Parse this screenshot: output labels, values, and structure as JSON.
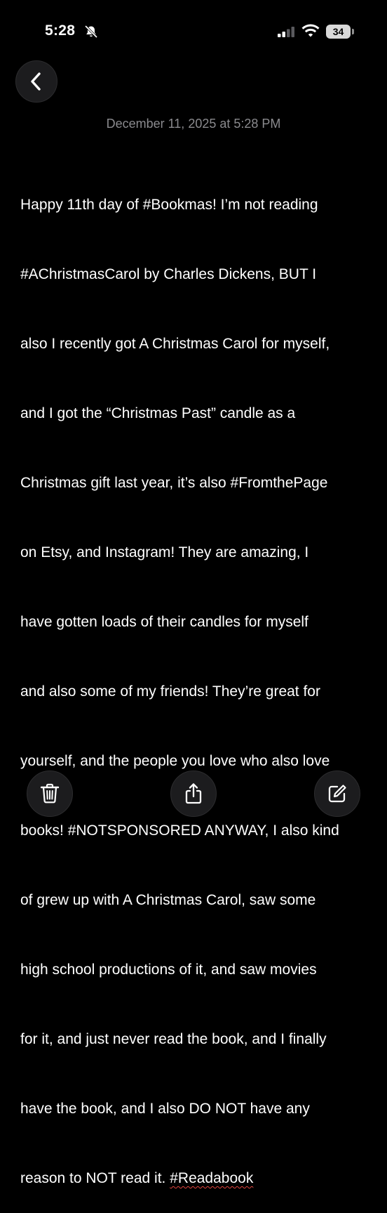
{
  "status_bar": {
    "time": "5:28",
    "battery_level": "34",
    "icons": [
      "bell-slash-icon",
      "cellular-signal-icon",
      "wifi-icon",
      "battery-icon"
    ]
  },
  "navigation": {
    "back_icon": "chevron-left-icon"
  },
  "note": {
    "date": "December 11, 2025 at 5:28 PM",
    "body_lines": [
      "Happy 11th day of #Bookmas! I’m not reading",
      "#AChristmasCarol by Charles Dickens, BUT I",
      "also I recently got A Christmas Carol for myself,",
      "and I got the “Christmas Past” candle as a",
      "Christmas gift last year, it’s also #FromthePage",
      "on Etsy, and Instagram! They are amazing, I",
      "have gotten loads of their candles for myself",
      "and also some of my friends! They’re great for",
      "yourself, and the people you love who also love",
      "books! #NOTSPONSORED ANYWAY, I also kind",
      "of grew up with A Christmas Carol, saw some",
      "high school productions of it, and saw movies",
      "for it, and just never read the book, and I finally",
      "have the book, and I also DO NOT have any",
      "reason to NOT read it. "
    ],
    "misspelled_word": "#Readabook"
  },
  "toolbar": {
    "icons": [
      "trash-icon",
      "share-icon",
      "compose-icon"
    ]
  },
  "colors": {
    "background": "#000000",
    "text": "#ffffff",
    "secondary_text": "#8a8a8e",
    "button_background": "#1c1c1e",
    "spellcheck": "#e0443e"
  }
}
